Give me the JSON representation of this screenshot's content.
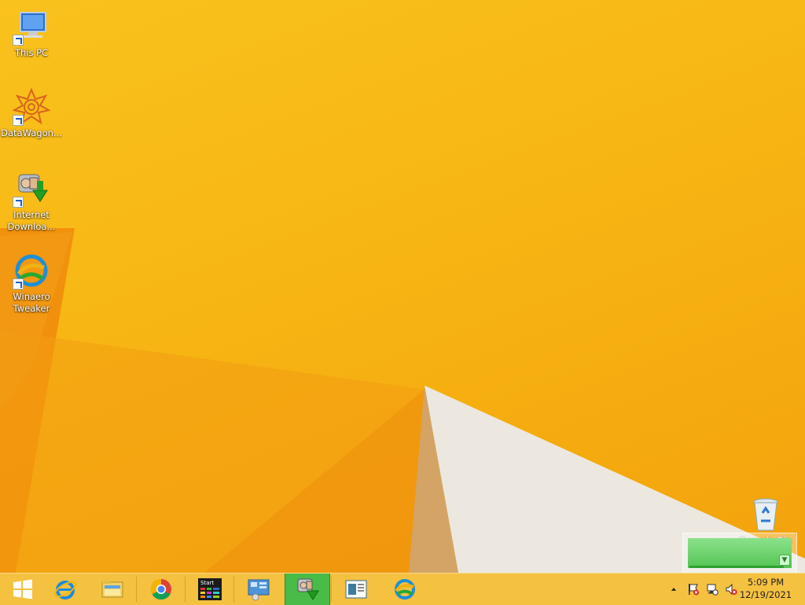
{
  "desktop": {
    "icons": [
      {
        "label_line1": "This PC",
        "label_line2": "",
        "icon": "this-pc-icon",
        "shortcut": true
      },
      {
        "label_line1": "DataWagon...",
        "label_line2": "",
        "icon": "datawagon-icon",
        "shortcut": true
      },
      {
        "label_line1": "Internet",
        "label_line2": "Downloa...",
        "icon": "internet-download-manager-icon",
        "shortcut": true
      },
      {
        "label_line1": "Winaero",
        "label_line2": "Tweaker",
        "icon": "winaero-tweaker-icon",
        "shortcut": true
      }
    ],
    "recycle_bin": {
      "label": "Recycle Bin",
      "icon": "recycle-bin-icon"
    }
  },
  "taskbar": {
    "pinned": [
      {
        "name": "start-button",
        "icon": "windows-logo-icon"
      },
      {
        "name": "internet-explorer",
        "icon": "internet-explorer-icon"
      },
      {
        "name": "file-explorer",
        "icon": "file-explorer-icon"
      },
      {
        "name": "chrome",
        "icon": "chrome-icon"
      },
      {
        "name": "start-menu-app",
        "icon": "start-tiles-icon",
        "text": "Start"
      },
      {
        "name": "control-panel",
        "icon": "control-panel-icon"
      },
      {
        "name": "internet-download-manager",
        "icon": "internet-download-manager-icon",
        "active": true
      },
      {
        "name": "document-viewer",
        "icon": "document-icon"
      },
      {
        "name": "winaero-tweaker",
        "icon": "winaero-tweaker-icon"
      }
    ],
    "tray": {
      "overflow": "show-hidden-icons",
      "icons": [
        "action-center-flag-icon",
        "network-icon",
        "volume-muted-icon"
      ]
    },
    "clock": {
      "time": "5:09 PM",
      "date": "12/19/2021"
    }
  },
  "colors": {
    "wallpaper": "#f7b513",
    "taskbar": "#f4c141",
    "active_app": "#48bb48"
  }
}
